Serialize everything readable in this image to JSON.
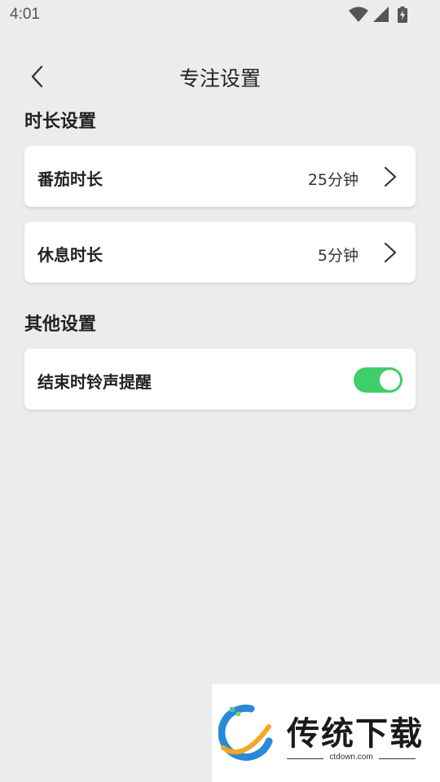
{
  "status_bar": {
    "time": "4:01",
    "icons": [
      "wifi-icon",
      "signal-icon",
      "battery-charging-icon"
    ]
  },
  "header": {
    "title": "专注设置",
    "back_icon": "chevron-left-icon"
  },
  "sections": [
    {
      "title": "时长设置",
      "items": [
        {
          "label": "番茄时长",
          "value": "25分钟",
          "icon": "chevron-right-icon"
        },
        {
          "label": "休息时长",
          "value": "5分钟",
          "icon": "chevron-right-icon"
        }
      ]
    },
    {
      "title": "其他设置",
      "items": [
        {
          "label": "结束时铃声提醒",
          "toggle_on": true
        }
      ]
    }
  ],
  "watermark": {
    "brand": "传统下载",
    "url": "ctdown.com"
  },
  "colors": {
    "background": "#ececec",
    "card": "#ffffff",
    "toggle_on": "#3ecf6a"
  }
}
